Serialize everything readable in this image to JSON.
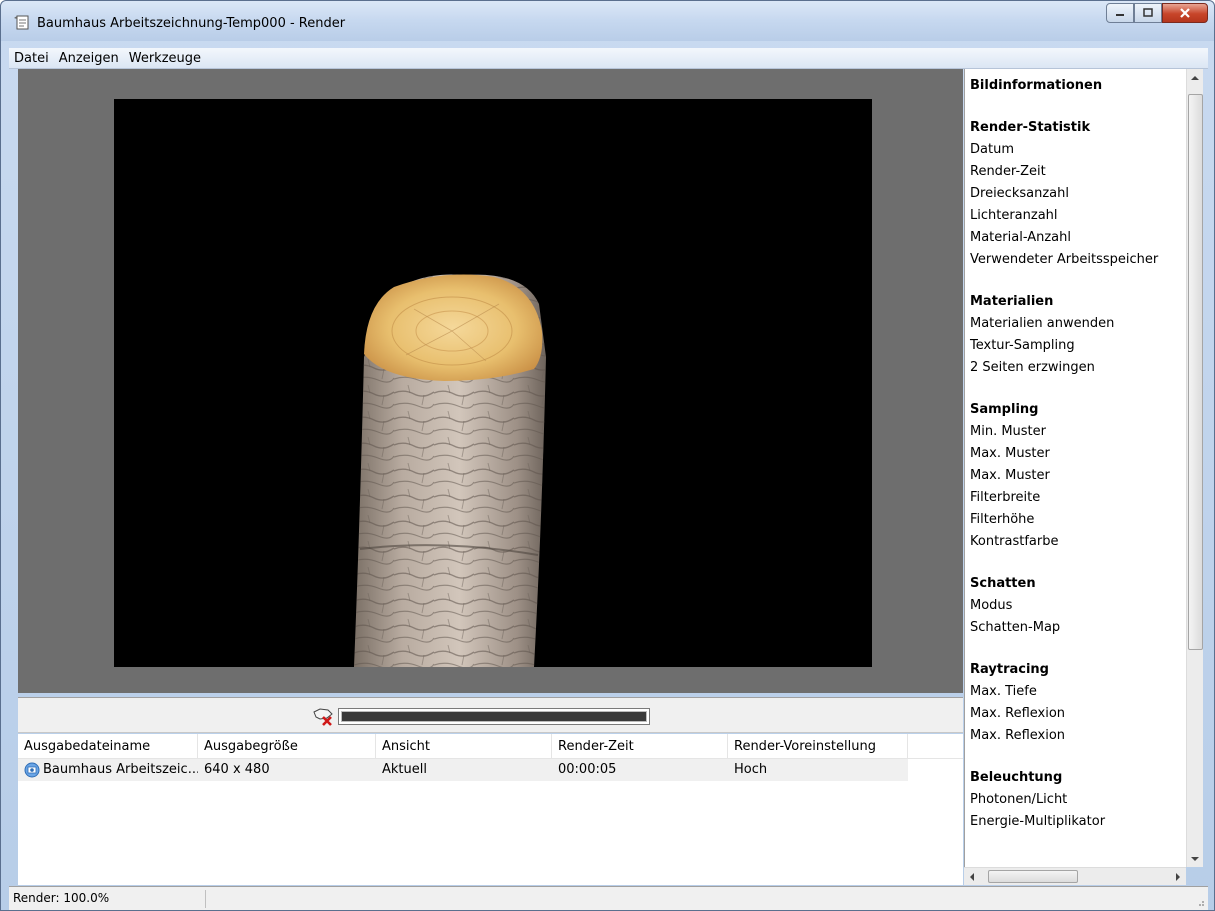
{
  "window": {
    "title": "Baumhaus Arbeitszeichnung-Temp000 - Render",
    "buttons": [
      "minimize",
      "maximize",
      "close"
    ]
  },
  "menu": [
    "Datei",
    "Anzeigen",
    "Werkzeuge"
  ],
  "render": {
    "progress_fraction": 1.0
  },
  "table": {
    "headers": [
      "Ausgabedateiname",
      "Ausgabegröße",
      "Ansicht",
      "Render-Zeit",
      "Render-Voreinstellung"
    ],
    "rows": [
      {
        "filename": "Baumhaus Arbeitszeic...",
        "size": "640 x 480",
        "view": "Aktuell",
        "time": "00:00:05",
        "preset": "Hoch"
      }
    ]
  },
  "info": {
    "title": "Bildinformationen",
    "sections": [
      {
        "title": "Render-Statistik",
        "items": [
          "Datum",
          "Render-Zeit",
          "Dreiecksanzahl",
          "Lichteranzahl",
          "Material-Anzahl",
          "Verwendeter Arbeitsspeicher"
        ]
      },
      {
        "title": "Materialien",
        "items": [
          "Materialien anwenden",
          "Textur-Sampling",
          "2 Seiten erzwingen"
        ]
      },
      {
        "title": "Sampling",
        "items": [
          "Min. Muster",
          "Max. Muster",
          "Max. Muster",
          "Filterbreite",
          "Filterhöhe",
          "Kontrastfarbe"
        ]
      },
      {
        "title": "Schatten",
        "items": [
          "Modus",
          "Schatten-Map"
        ]
      },
      {
        "title": "Raytracing",
        "items": [
          "Max. Tiefe",
          "Max. Reflexion",
          "Max. Reflexion"
        ]
      },
      {
        "title": "Beleuchtung",
        "items": [
          "Photonen/Licht",
          "Energie-Multiplikator"
        ]
      }
    ]
  },
  "status": {
    "text": "Render: 100.0%"
  },
  "icons": {
    "window_icon": "render-window-icon",
    "stop": "stop-render-icon",
    "file": "rendered-file-icon"
  }
}
